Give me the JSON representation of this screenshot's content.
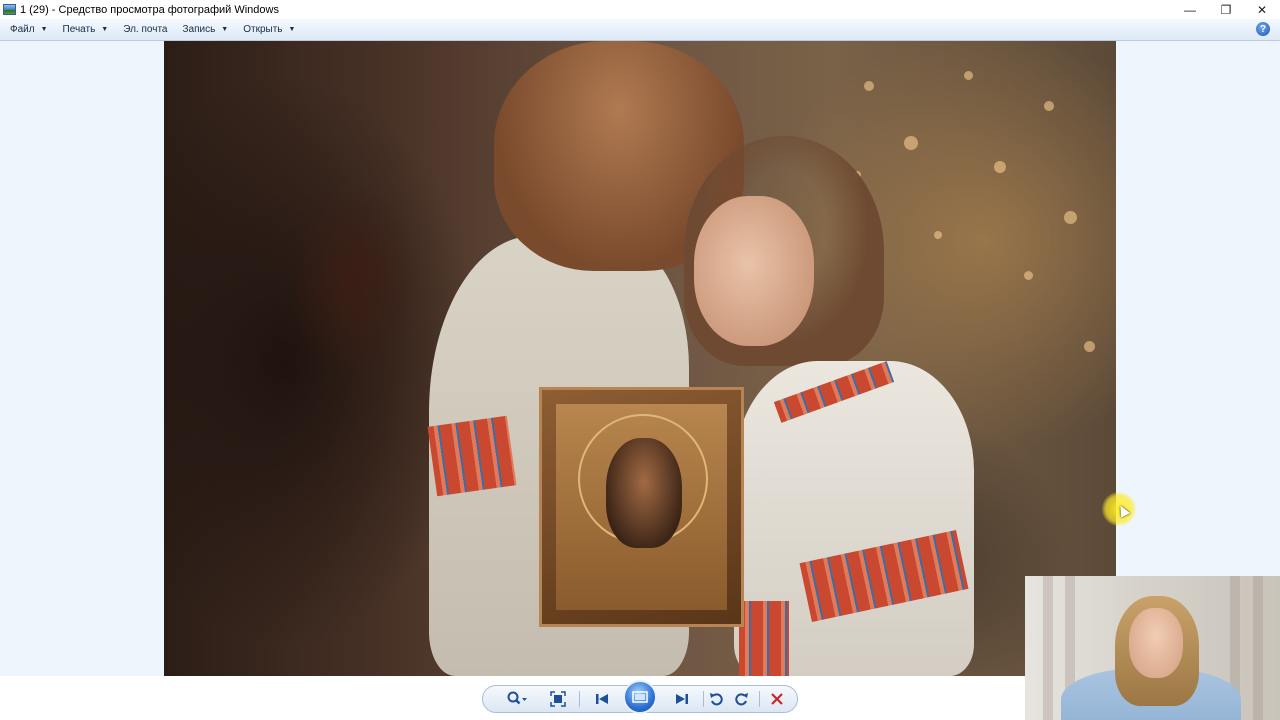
{
  "window": {
    "title": "1 (29) - Средство просмотра фотографий Windows",
    "controls": {
      "minimize_glyph": "—",
      "restore_glyph": "❐",
      "close_glyph": "✕"
    }
  },
  "menu": {
    "items": [
      {
        "label": "Файл",
        "has_dropdown": true
      },
      {
        "label": "Печать",
        "has_dropdown": true
      },
      {
        "label": "Эл. почта",
        "has_dropdown": false
      },
      {
        "label": "Запись",
        "has_dropdown": true
      },
      {
        "label": "Открыть",
        "has_dropdown": true
      }
    ],
    "dropdown_glyph": "▼",
    "help_glyph": "?"
  },
  "viewer": {
    "image_subject": "photo-two-children-holding-icon",
    "background_color": "#eef5fd"
  },
  "toolbar": {
    "buttons": [
      {
        "name": "zoom-button",
        "icon": "magnifier-icon"
      },
      {
        "name": "actual-size-button",
        "icon": "fit-to-window-icon"
      },
      {
        "name": "previous-button",
        "icon": "skip-previous-icon"
      },
      {
        "name": "slideshow-button",
        "icon": "slideshow-icon"
      },
      {
        "name": "next-button",
        "icon": "skip-next-icon"
      },
      {
        "name": "rotate-ccw-button",
        "icon": "rotate-counterclockwise-icon"
      },
      {
        "name": "rotate-cw-button",
        "icon": "rotate-clockwise-icon"
      },
      {
        "name": "delete-button",
        "icon": "delete-x-icon"
      }
    ],
    "accent_color": "#1e4f97",
    "delete_color": "#c62828"
  },
  "overlay": {
    "webcam": "presenter-webcam-feed",
    "cursor_highlight_color": "#fff028"
  }
}
